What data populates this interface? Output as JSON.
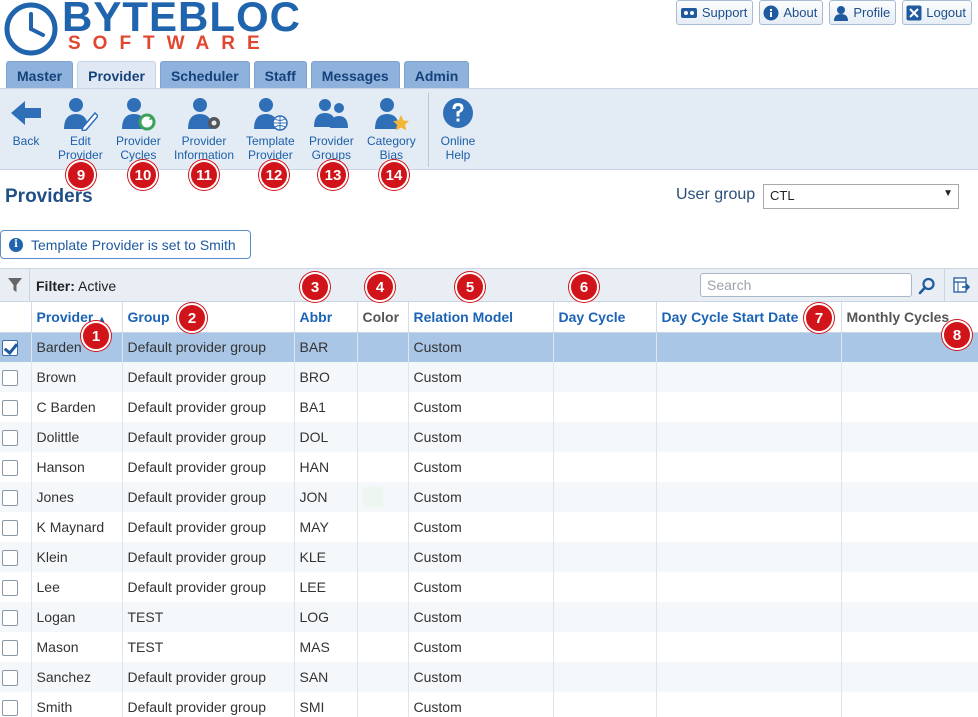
{
  "brand": {
    "name": "BYTEBLOC",
    "sub": "SOFTWARE"
  },
  "top_links": [
    {
      "label": "Support",
      "icon": "support-icon"
    },
    {
      "label": "About",
      "icon": "info-icon"
    },
    {
      "label": "Profile",
      "icon": "user-icon"
    },
    {
      "label": "Logout",
      "icon": "close-icon"
    }
  ],
  "tabs": [
    "Master",
    "Provider",
    "Scheduler",
    "Staff",
    "Messages",
    "Admin"
  ],
  "active_tab": "Provider",
  "toolbar": [
    {
      "label": "Back",
      "icon": "back-arrow-icon"
    },
    {
      "label": "Edit\nProvider",
      "icon": "edit-provider-icon"
    },
    {
      "label": "Provider\nCycles",
      "icon": "provider-cycles-icon"
    },
    {
      "label": "Provider\nInformation",
      "icon": "provider-information-icon"
    },
    {
      "label": "Template\nProvider",
      "icon": "template-provider-icon"
    },
    {
      "label": "Provider\nGroups",
      "icon": "provider-groups-icon"
    },
    {
      "label": "Category\nBias",
      "icon": "category-bias-icon"
    },
    {
      "label": "Online\nHelp",
      "icon": "help-icon"
    }
  ],
  "callouts": [
    "1",
    "2",
    "3",
    "4",
    "5",
    "6",
    "7",
    "8",
    "9",
    "10",
    "11",
    "12",
    "13",
    "14"
  ],
  "page_title": "Providers",
  "user_group": {
    "label": "User group",
    "value": "CTL"
  },
  "info_message": "Template Provider is set to Smith",
  "filter": {
    "label": "Filter:",
    "value": "Active"
  },
  "search": {
    "placeholder": "Search"
  },
  "columns": [
    "Provider",
    "Group",
    "Abbr",
    "Color",
    "Relation Model",
    "Day Cycle",
    "Day Cycle Start Date",
    "Monthly Cycles"
  ],
  "rows": [
    {
      "provider": "Barden",
      "group": "Default provider group",
      "abbr": "BAR",
      "color": "",
      "relation_model": "Custom",
      "day_cycle": "",
      "day_cycle_start": "",
      "monthly_cycles": "",
      "selected": true
    },
    {
      "provider": "Brown",
      "group": "Default provider group",
      "abbr": "BRO",
      "color": "",
      "relation_model": "Custom",
      "day_cycle": "",
      "day_cycle_start": "",
      "monthly_cycles": ""
    },
    {
      "provider": "C Barden",
      "group": "Default provider group",
      "abbr": "BA1",
      "color": "",
      "relation_model": "Custom",
      "day_cycle": "",
      "day_cycle_start": "",
      "monthly_cycles": ""
    },
    {
      "provider": "Dolittle",
      "group": "Default provider group",
      "abbr": "DOL",
      "color": "",
      "relation_model": "Custom",
      "day_cycle": "",
      "day_cycle_start": "",
      "monthly_cycles": ""
    },
    {
      "provider": "Hanson",
      "group": "Default provider group",
      "abbr": "HAN",
      "color": "",
      "relation_model": "Custom",
      "day_cycle": "",
      "day_cycle_start": "",
      "monthly_cycles": ""
    },
    {
      "provider": "Jones",
      "group": "Default provider group",
      "abbr": "JON",
      "color": "#edf7f0",
      "relation_model": "Custom",
      "day_cycle": "",
      "day_cycle_start": "",
      "monthly_cycles": ""
    },
    {
      "provider": "K Maynard",
      "group": "Default provider group",
      "abbr": "MAY",
      "color": "",
      "relation_model": "Custom",
      "day_cycle": "",
      "day_cycle_start": "",
      "monthly_cycles": ""
    },
    {
      "provider": "Klein",
      "group": "Default provider group",
      "abbr": "KLE",
      "color": "",
      "relation_model": "Custom",
      "day_cycle": "",
      "day_cycle_start": "",
      "monthly_cycles": ""
    },
    {
      "provider": "Lee",
      "group": "Default provider group",
      "abbr": "LEE",
      "color": "",
      "relation_model": "Custom",
      "day_cycle": "",
      "day_cycle_start": "",
      "monthly_cycles": ""
    },
    {
      "provider": "Logan",
      "group": "TEST",
      "abbr": "LOG",
      "color": "",
      "relation_model": "Custom",
      "day_cycle": "",
      "day_cycle_start": "",
      "monthly_cycles": ""
    },
    {
      "provider": "Mason",
      "group": "TEST",
      "abbr": "MAS",
      "color": "",
      "relation_model": "Custom",
      "day_cycle": "",
      "day_cycle_start": "",
      "monthly_cycles": ""
    },
    {
      "provider": "Sanchez",
      "group": "Default provider group",
      "abbr": "SAN",
      "color": "",
      "relation_model": "Custom",
      "day_cycle": "",
      "day_cycle_start": "",
      "monthly_cycles": ""
    },
    {
      "provider": "Smith",
      "group": "Default provider group",
      "abbr": "SMI",
      "color": "",
      "relation_model": "Custom",
      "day_cycle": "",
      "day_cycle_start": "",
      "monthly_cycles": ""
    }
  ],
  "colors": {
    "brand_blue": "#1f64ad",
    "brand_red": "#e3462e",
    "callout_red": "#d0141a",
    "selected_row": "#a9c6e6"
  }
}
